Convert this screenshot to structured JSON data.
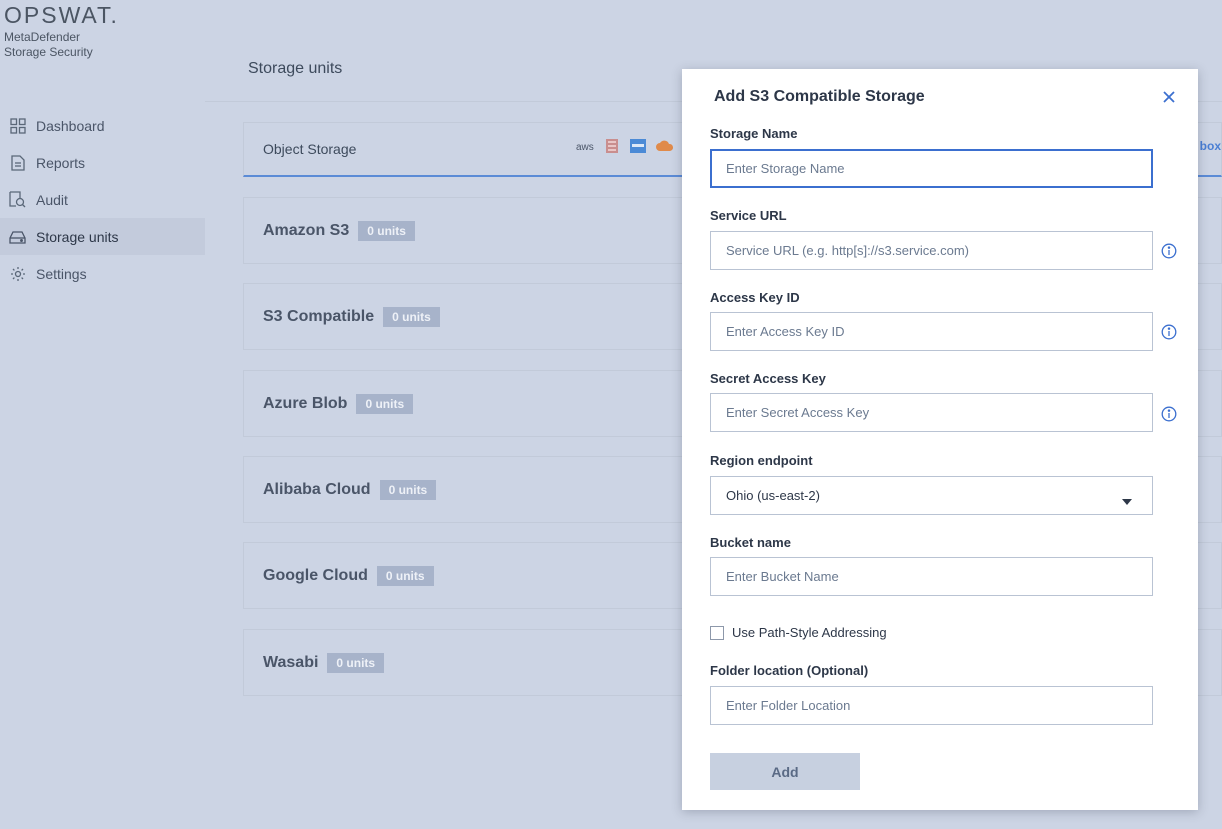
{
  "brand": {
    "logo": "OPSWAT.",
    "product_line1": "MetaDefender",
    "product_line2": "Storage Security"
  },
  "sidebar": {
    "items": [
      {
        "label": "Dashboard",
        "icon": "grid-icon"
      },
      {
        "label": "Reports",
        "icon": "document-icon"
      },
      {
        "label": "Audit",
        "icon": "audit-icon"
      },
      {
        "label": "Storage units",
        "icon": "storage-icon",
        "active": true
      },
      {
        "label": "Settings",
        "icon": "gear-icon"
      }
    ]
  },
  "main": {
    "title": "Storage units",
    "tab_label": "Object Storage",
    "provider_icons": [
      "aws-icon",
      "storage-provider-icon",
      "azure-icon",
      "cloud-icon",
      "box-icon"
    ],
    "aws_text": "aws",
    "box_text": "box",
    "cards": [
      {
        "name": "Amazon S3",
        "badge": "0 units"
      },
      {
        "name": "S3 Compatible",
        "badge": "0 units"
      },
      {
        "name": "Azure Blob",
        "badge": "0 units"
      },
      {
        "name": "Alibaba Cloud",
        "badge": "0 units"
      },
      {
        "name": "Google Cloud",
        "badge": "0 units"
      },
      {
        "name": "Wasabi",
        "badge": "0 units"
      }
    ]
  },
  "modal": {
    "title": "Add S3 Compatible Storage",
    "storage_name": {
      "label": "Storage Name",
      "placeholder": "Enter Storage Name",
      "value": ""
    },
    "service_url": {
      "label": "Service URL",
      "placeholder": "Service URL (e.g. http[s]://s3.service.com)",
      "value": ""
    },
    "access_key": {
      "label": "Access Key ID",
      "placeholder": "Enter Access Key ID",
      "value": ""
    },
    "secret_key": {
      "label": "Secret Access Key",
      "placeholder": "Enter Secret Access Key",
      "value": ""
    },
    "region": {
      "label": "Region endpoint",
      "value": "Ohio (us-east-2)"
    },
    "bucket": {
      "label": "Bucket name",
      "placeholder": "Enter Bucket Name",
      "value": ""
    },
    "path_style": {
      "label": "Use Path-Style Addressing",
      "checked": false
    },
    "folder": {
      "label": "Folder location (Optional)",
      "placeholder": "Enter Folder Location",
      "value": ""
    },
    "add_button": "Add"
  },
  "colors": {
    "background": "#ccd4e4",
    "accent": "#3b6fcf",
    "badge": "#a7b3ca"
  }
}
